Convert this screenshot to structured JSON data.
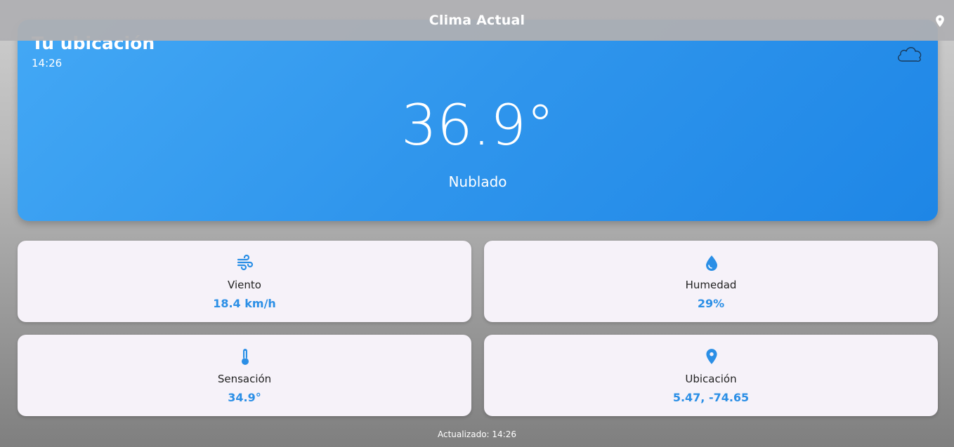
{
  "appbar": {
    "title": "Clima Actual",
    "icon": "location-pin-icon"
  },
  "hero": {
    "location": "Tu ubicación",
    "time": "14:26",
    "temperature": "36.9°",
    "condition": "Nublado",
    "icon": "cloud-icon"
  },
  "cards": [
    {
      "label": "Viento",
      "value": "18.4 km/h",
      "icon": "wind-icon"
    },
    {
      "label": "Humedad",
      "value": "29%",
      "icon": "water-drop-icon"
    },
    {
      "label": "Sensación",
      "value": "34.9°",
      "icon": "thermometer-icon"
    },
    {
      "label": "Ubicación",
      "value": "5.47, -74.65",
      "icon": "location-pin-icon"
    }
  ],
  "footer": {
    "updated": "Actualizado: 14:26"
  },
  "colors": {
    "accent": "#2b8fe6",
    "hero_start": "#43a8f5",
    "hero_end": "#1e86e6",
    "card_bg": "#f6f2f9"
  }
}
